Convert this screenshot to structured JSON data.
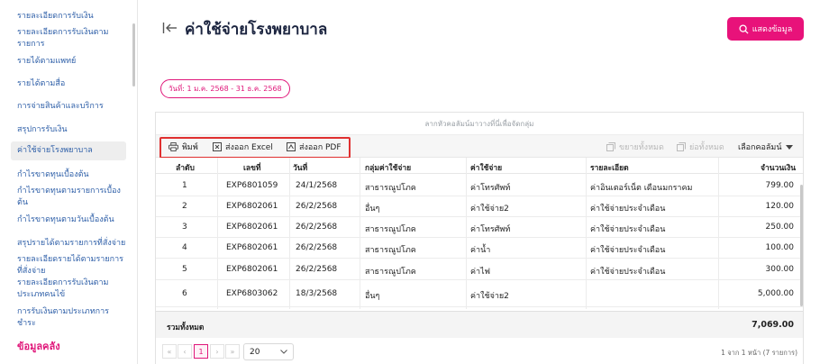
{
  "sidebar": {
    "items": [
      {
        "label": "รายละเอียดการรับเงิน"
      },
      {
        "label": "รายละเอียดการรับเงินตามรายการ"
      },
      {
        "label": "รายได้ตามแพทย์"
      },
      {
        "label": "รายได้ตามสื่อ"
      },
      {
        "label": "การจ่ายสินค้าและบริการ"
      },
      {
        "label": "สรุปการรับเงิน"
      },
      {
        "label": "ค่าใช้จ่ายโรงพยาบาล"
      },
      {
        "label": "กำไรขาดทุนเบื้องต้น"
      },
      {
        "label": "กำไรขาดทุนตามรายการเบื้องต้น"
      },
      {
        "label": "กำไรขาดทุนตามวันเบื้องต้น"
      },
      {
        "label": "สรุปรายได้ตามรายการที่สั่งจ่าย"
      },
      {
        "label": "รายละเอียดรายได้ตามรายการที่สั่งจ่าย"
      },
      {
        "label": "รายละเอียดการรับเงินตามประเภทคนไข้"
      },
      {
        "label": "การรับเงินตามประเภทการชำระ"
      }
    ],
    "section": "ข้อมูลคลัง"
  },
  "header": {
    "title": "ค่าใช้จ่ายโรงพยาบาล",
    "show_button": "แสดงข้อมูล",
    "date_range": "วันที่: 1 ม.ค. 2568 - 31 ธ.ค. 2568"
  },
  "grid": {
    "group_hint": "ลากหัวคอลัมน์มาวางที่นี่เพื่อจัดกลุ่ม",
    "toolbar": {
      "print": "พิมพ์",
      "export_excel": "ส่งออก Excel",
      "export_pdf": "ส่งออก PDF",
      "expand_all": "ขยายทั้งหมด",
      "collapse_all": "ย่อทั้งหมด",
      "choose_columns": "เลือกคอลัมน์"
    },
    "columns": [
      "ลำดับ",
      "เลขที่",
      "วันที่",
      "กลุ่มค่าใช้จ่าย",
      "ค่าใช้จ่าย",
      "รายละเอียด",
      "จำนวนเงิน"
    ],
    "rows": [
      [
        "1",
        "EXP6801059",
        "24/1/2568",
        "สาธารณูปโภค",
        "ค่าโทรศัพท์",
        "ค่าอินเตอร์เน็ต เดือนมกราคม",
        "799.00"
      ],
      [
        "2",
        "EXP6802061",
        "26/2/2568",
        "อื่นๆ",
        "ค่าใช้จ่าย2",
        "ค่าใช้จ่ายประจำเดือน",
        "120.00"
      ],
      [
        "3",
        "EXP6802061",
        "26/2/2568",
        "สาธารณูปโภค",
        "ค่าโทรศัพท์",
        "ค่าใช้จ่ายประจำเดือน",
        "250.00"
      ],
      [
        "4",
        "EXP6802061",
        "26/2/2568",
        "สาธารณูปโภค",
        "ค่าน้ำ",
        "ค่าใช้จ่ายประจำเดือน",
        "100.00"
      ],
      [
        "5",
        "EXP6802061",
        "26/2/2568",
        "สาธารณูปโภค",
        "ค่าไฟ",
        "ค่าใช้จ่ายประจำเดือน",
        "300.00"
      ],
      [
        "6",
        "EXP6803062",
        "18/3/2568",
        "อื่นๆ",
        "ค่าใช้จ่าย2",
        "",
        "5,000.00"
      ]
    ],
    "total_label": "รวมทั้งหมด",
    "total_value": "7,069.00",
    "pager": {
      "first": "«",
      "prev": "‹",
      "current": "1",
      "next": "›",
      "last": "»",
      "page_size": "20",
      "info": "1 จาก 1 หน้า (7 รายการ)"
    }
  },
  "colors": {
    "accent": "#e8127a",
    "link": "#2e5fa8",
    "highlight_border": "#e03030"
  }
}
